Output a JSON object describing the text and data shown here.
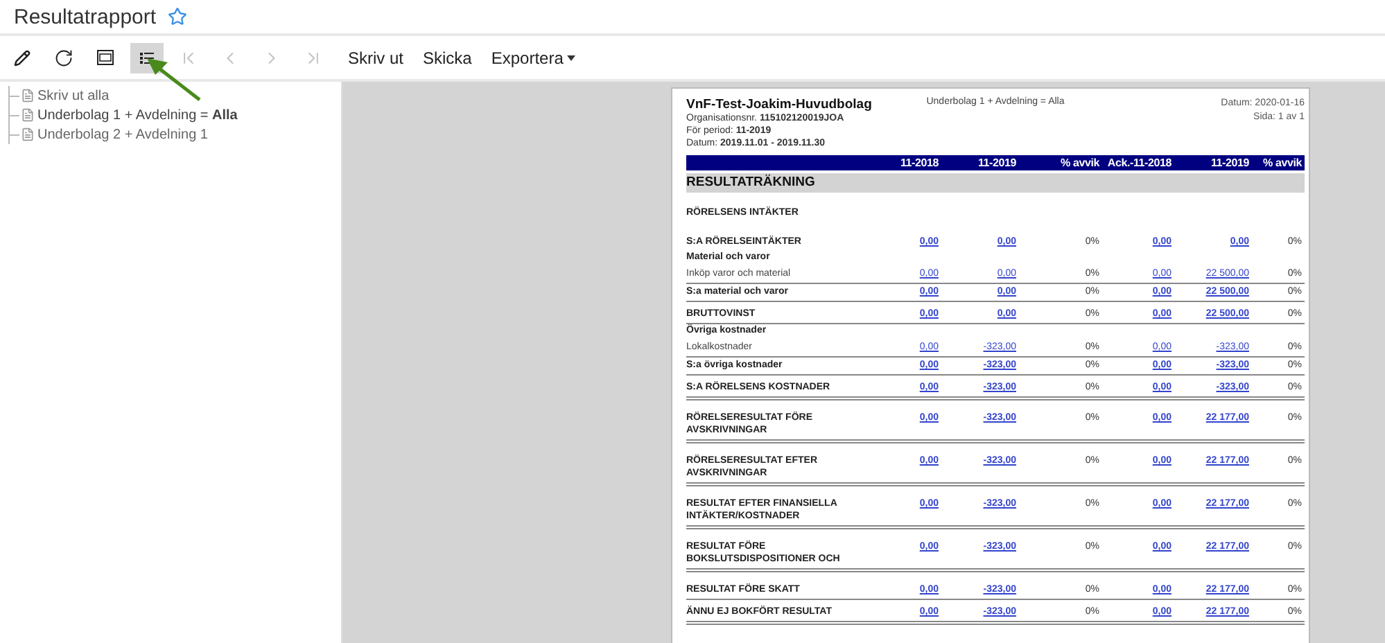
{
  "window": {
    "title": "Resultatrapport",
    "favorite": false
  },
  "toolbar": [
    {
      "kind": "edit",
      "disabled": false,
      "selected": false
    },
    {
      "kind": "refresh",
      "disabled": false,
      "selected": false
    },
    {
      "kind": "fit",
      "disabled": false,
      "selected": false
    },
    {
      "kind": "outline",
      "disabled": false,
      "selected": true
    },
    {
      "kind": "first",
      "disabled": true,
      "selected": false
    },
    {
      "kind": "prev",
      "disabled": true,
      "selected": false
    },
    {
      "kind": "next",
      "disabled": true,
      "selected": false
    },
    {
      "kind": "last",
      "disabled": true,
      "selected": false
    },
    {
      "kind": "text",
      "label": "Skriv ut",
      "disabled": false,
      "selected": false
    },
    {
      "kind": "text",
      "label": "Skicka",
      "disabled": false,
      "selected": false
    },
    {
      "kind": "menu",
      "label": "Exportera",
      "disabled": false,
      "selected": false
    }
  ],
  "tree": [
    {
      "label": "Skriv ut alla",
      "selected": false
    },
    {
      "label": "Underbolag 1 + Avdelning = **Alla**",
      "selected": true
    },
    {
      "label": "Underbolag 2 + Avdelning 1",
      "selected": false
    }
  ],
  "report": {
    "company": "VnF-Test-Joakim-Huvudbolag",
    "filter": "Underbolag 1 + Avdelning = Alla",
    "date": "Datum: 2020-01-16",
    "page": "Sida: 1 av 1",
    "info": [
      {
        "label": "Organisationsnr.",
        "value": "115102120019JOA"
      },
      {
        "label": "För period:",
        "value": "11-2019"
      },
      {
        "label": "Datum:",
        "value": "2019.11.01 -  2019.11.30"
      }
    ],
    "columns": [
      {
        "label": "11-2018",
        "kind": "link"
      },
      {
        "label": "11-2019",
        "kind": "link"
      },
      {
        "label": "% avvik",
        "kind": "plain"
      },
      {
        "label": "Ack.-11-2018",
        "kind": "link"
      },
      {
        "label": "11-2019",
        "kind": "link"
      },
      {
        "label": "% avvik",
        "kind": "plain"
      }
    ],
    "title": "RESULTATRÄKNING",
    "rows": [
      {
        "kind": "section",
        "label": "RÖRELSENS INTÄKTER"
      },
      {
        "kind": "lead",
        "label": "S:A RÖRELSEINTÄKTER",
        "values": [
          "0,00",
          "0,00",
          "0%",
          "0,00",
          "0,00",
          "0%"
        ]
      },
      {
        "kind": "group",
        "label": "Material och varor"
      },
      {
        "kind": "detail",
        "label": "Inköp varor och material",
        "values": [
          "0,00",
          "0,00",
          "0%",
          "0,00",
          "22 500,00",
          "0%"
        ]
      },
      {
        "kind": "subtotal",
        "label": "S:a material och varor",
        "values": [
          "0,00",
          "0,00",
          "0%",
          "0,00",
          "22 500,00",
          "0%"
        ]
      },
      {
        "kind": "sum",
        "label": "BRUTTOVINST",
        "values": [
          "0,00",
          "0,00",
          "0%",
          "0,00",
          "22 500,00",
          "0%"
        ]
      },
      {
        "kind": "group",
        "label": "Övriga kostnader"
      },
      {
        "kind": "detail",
        "label": "Lokalkostnader",
        "values": [
          "0,00",
          "-323,00",
          "0%",
          "0,00",
          "-323,00",
          "0%"
        ]
      },
      {
        "kind": "subtotal",
        "label": "S:a övriga kostnader",
        "values": [
          "0,00",
          "-323,00",
          "0%",
          "0,00",
          "-323,00",
          "0%"
        ]
      },
      {
        "kind": "total",
        "label": "S:A RÖRELSENS KOSTNADER",
        "values": [
          "0,00",
          "-323,00",
          "0%",
          "0,00",
          "-323,00",
          "0%"
        ]
      },
      {
        "kind": "total",
        "label": "RÖRELSERESULTAT FÖRE AVSKRIVNINGAR",
        "values": [
          "0,00",
          "-323,00",
          "0%",
          "0,00",
          "22 177,00",
          "0%"
        ]
      },
      {
        "kind": "total",
        "label": "RÖRELSERESULTAT EFTER AVSKRIVNINGAR",
        "values": [
          "0,00",
          "-323,00",
          "0%",
          "0,00",
          "22 177,00",
          "0%"
        ]
      },
      {
        "kind": "total",
        "label": "RESULTAT EFTER FINANSIELLA INTÄKTER/KOSTNADER",
        "values": [
          "0,00",
          "-323,00",
          "0%",
          "0,00",
          "22 177,00",
          "0%"
        ]
      },
      {
        "kind": "total",
        "label": "RESULTAT FÖRE BOKSLUTSDISPOSITIONER OCH",
        "values": [
          "0,00",
          "-323,00",
          "0%",
          "0,00",
          "22 177,00",
          "0%"
        ]
      },
      {
        "kind": "sum",
        "label": "RESULTAT FÖRE SKATT",
        "values": [
          "0,00",
          "-323,00",
          "0%",
          "0,00",
          "22 177,00",
          "0%"
        ]
      },
      {
        "kind": "total",
        "label": "ÄNNU EJ BOKFÖRT RESULTAT",
        "values": [
          "0,00",
          "-323,00",
          "0%",
          "0,00",
          "22 177,00",
          "0%"
        ]
      }
    ]
  }
}
